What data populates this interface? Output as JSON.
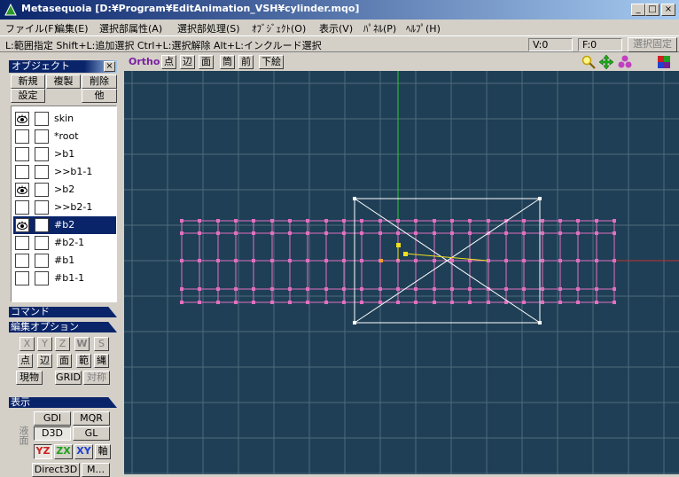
{
  "window": {
    "title": "Metasequoia [D:¥Program¥EditAnimation_VSH¥cylinder.mqo]",
    "minimize": "_",
    "maximize": "□",
    "close": "×"
  },
  "menu": [
    "ファイル(F)",
    "編集(E)",
    "選択部属性(A)",
    "選択部処理(S)",
    "ｵﾌﾞｼﾞｪｸﾄ(O)",
    "表示(V)",
    "ﾊﾟﾈﾙ(P)",
    "ﾍﾙﾌﾟ(H)"
  ],
  "status": {
    "hint": "L:範囲指定  Shift+L:追加選択  Ctrl+L:選択解除  Alt+L:インクルード選択",
    "vertex_count": "V:0",
    "face_count": "F:0",
    "lock_selection": "選択固定"
  },
  "viewport_toolbar": {
    "ortho": "Ortho",
    "buttons": [
      "点",
      "辺",
      "面",
      "筒",
      "前",
      "下絵"
    ]
  },
  "object_panel": {
    "title": "オブジェクト",
    "close": "×",
    "buttons": {
      "new": "新規",
      "duplicate": "複製",
      "delete": "削除",
      "settings": "設定",
      "other": "他"
    },
    "objects": [
      {
        "name": "skin",
        "visible": true,
        "selected": false
      },
      {
        "name": "*root",
        "visible": false,
        "selected": false
      },
      {
        "name": ">b1",
        "visible": false,
        "selected": false
      },
      {
        "name": ">>b1-1",
        "visible": false,
        "selected": false
      },
      {
        "name": ">b2",
        "visible": true,
        "selected": false
      },
      {
        "name": ">>b2-1",
        "visible": false,
        "selected": false
      },
      {
        "name": "#b2",
        "visible": true,
        "selected": true
      },
      {
        "name": "#b2-1",
        "visible": false,
        "selected": false
      },
      {
        "name": "#b1",
        "visible": false,
        "selected": false
      },
      {
        "name": "#b1-1",
        "visible": false,
        "selected": false
      }
    ]
  },
  "command_panel": {
    "title": "コマンド"
  },
  "edit_options": {
    "title": "編集オプション",
    "axes": [
      "X",
      "Y",
      "Z",
      "W",
      "S"
    ],
    "modes": [
      "点",
      "辺",
      "面",
      "範",
      "縄"
    ],
    "current": "現物",
    "grid": "GRID",
    "symmetry": "対称"
  },
  "display_panel": {
    "title": "表示",
    "side_label": "液面",
    "gdi": "GDI",
    "mqr": "MQR",
    "d3d": "D3D",
    "gl": "GL",
    "planes": [
      "YZ",
      "ZX",
      "XY"
    ],
    "axis": "軸",
    "direct3d": "Direct3D",
    "more": "M..."
  },
  "colors": {
    "viewport_bg": "#1f3f56",
    "grid": "#4f6b7c",
    "mesh": "#e070c0",
    "selection_box": "#ffffff",
    "y_axis": "#2ecc2e",
    "x_axis": "#c03030",
    "selected_row": "#0a246a"
  }
}
